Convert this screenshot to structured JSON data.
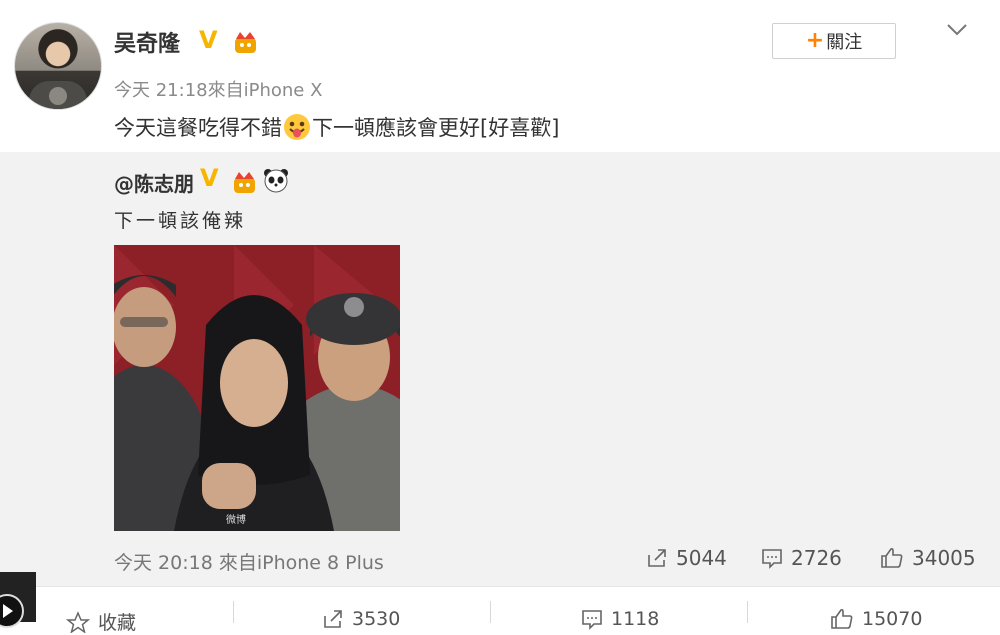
{
  "post": {
    "author": "吴奇隆",
    "time": "今天 21:18",
    "source": "來自iPhone X",
    "text_before": "今天這餐吃得不錯",
    "text_after": "下一頓應該會更好[好喜歡]",
    "follow_label": "關注"
  },
  "repost": {
    "author": "@陈志朋",
    "text": "下一頓該俺辣",
    "meta": "今天 20:18 來自iPhone 8 Plus",
    "reposts": "5044",
    "comments": "2726",
    "likes": "34005"
  },
  "footer": {
    "favorite_label": "收藏",
    "reposts": "3530",
    "comments": "1118",
    "likes": "15070"
  },
  "colors": {
    "accent": "#ff8200",
    "verified": "#f7b500",
    "repost_bg": "#f2f2f2"
  }
}
